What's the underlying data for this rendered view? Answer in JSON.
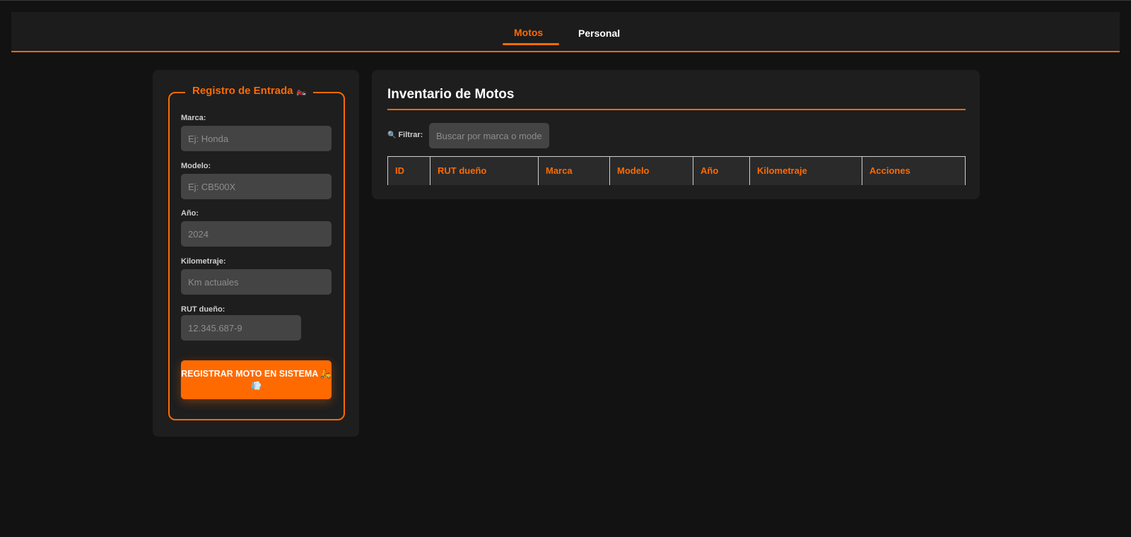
{
  "nav": {
    "tabs": [
      {
        "label": "Motos",
        "active": true
      },
      {
        "label": "Personal",
        "active": false
      }
    ]
  },
  "form": {
    "legend": "Registro de Entrada",
    "legend_emoji": "🏍️",
    "fields": [
      {
        "label": "Marca:",
        "placeholder": "Ej: Honda"
      },
      {
        "label": "Modelo:",
        "placeholder": "Ej: CB500X"
      },
      {
        "label": "Año:",
        "placeholder": "2024"
      },
      {
        "label": "Kilometraje:",
        "placeholder": "Km actuales"
      },
      {
        "label": "RUT dueño:",
        "placeholder": "12.345.687-9"
      }
    ],
    "submit_label": "REGISTRAR MOTO EN SISTEMA 🛵💨"
  },
  "inventory": {
    "title": "Inventario de Motos",
    "filter_icon": "🔍",
    "filter_label": "Filtrar:",
    "filter_placeholder": "Buscar por marca o modelo",
    "columns": [
      "ID",
      "RUT dueño",
      "Marca",
      "Modelo",
      "Año",
      "Kilometraje",
      "Acciones"
    ]
  },
  "colors": {
    "accent": "#ff6a00",
    "background": "#121212",
    "card": "#1e1e1e",
    "input": "#444444"
  }
}
